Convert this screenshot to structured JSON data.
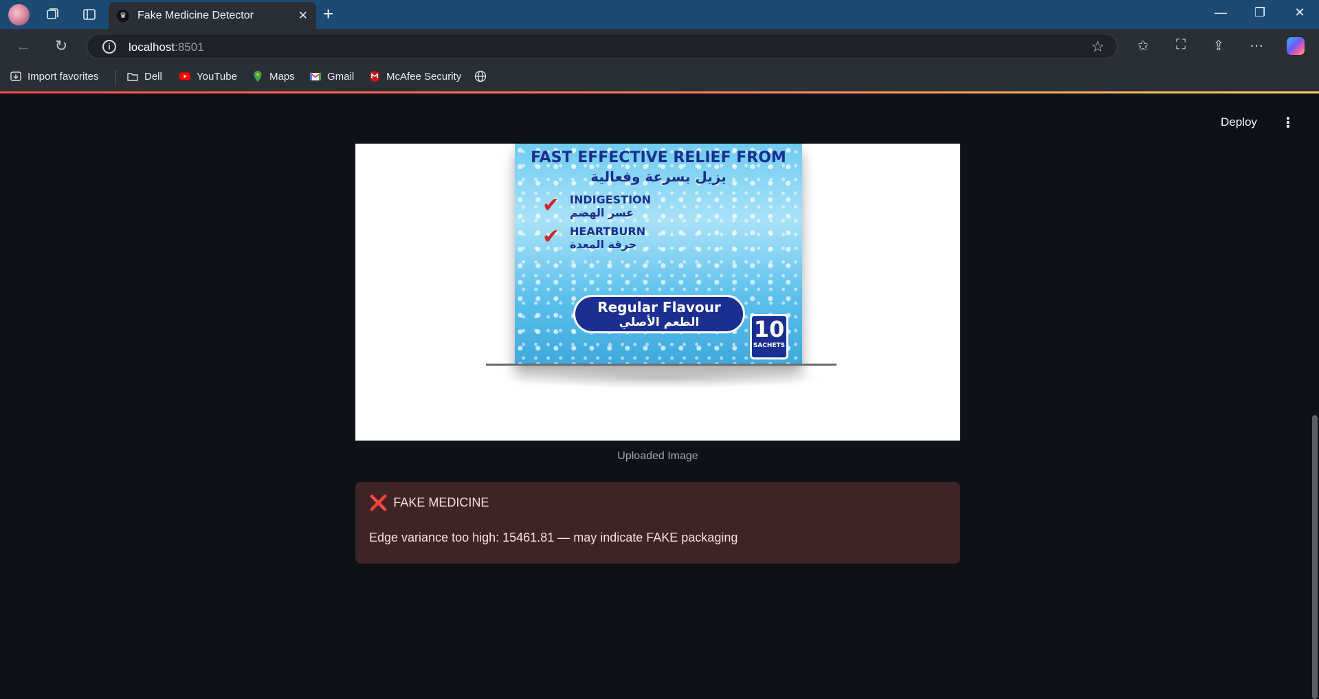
{
  "browser": {
    "tab": {
      "title": "Fake Medicine Detector",
      "favicon": "streamlit-crown-icon"
    },
    "new_tab_label": "+",
    "address": {
      "host": "localhost",
      "port": ":8501"
    },
    "bookmarks": [
      {
        "label": "Import favorites",
        "icon": "import-icon"
      },
      {
        "label": "Dell",
        "icon": "folder-icon"
      },
      {
        "label": "YouTube",
        "icon": "youtube-icon"
      },
      {
        "label": "Maps",
        "icon": "maps-pin-icon"
      },
      {
        "label": "Gmail",
        "icon": "gmail-icon"
      },
      {
        "label": "McAfee Security",
        "icon": "mcafee-icon"
      }
    ]
  },
  "app": {
    "header": {
      "deploy_label": "Deploy",
      "menu_icon": "kebab-menu-icon"
    },
    "uploaded_image": {
      "caption": "Uploaded Image",
      "headline": "FAST EFFECTIVE RELIEF FROM",
      "headline_ar": "يزيل بسرعة وفعالية",
      "claims": [
        {
          "en": "INDIGESTION",
          "ar": "عسر الهضم"
        },
        {
          "en": "HEARTBURN",
          "ar": "حرقة المعدة"
        }
      ],
      "flavour_en": "Regular Flavour",
      "flavour_ar": "الطعم الأصلي",
      "sachet_count": "10",
      "sachet_label": "SACHETS"
    },
    "result": {
      "icon": "❌",
      "title": "FAKE MEDICINE",
      "message": "Edge variance too high: 15461.81 — may indicate FAKE packaging",
      "color": "#3e2327"
    }
  }
}
